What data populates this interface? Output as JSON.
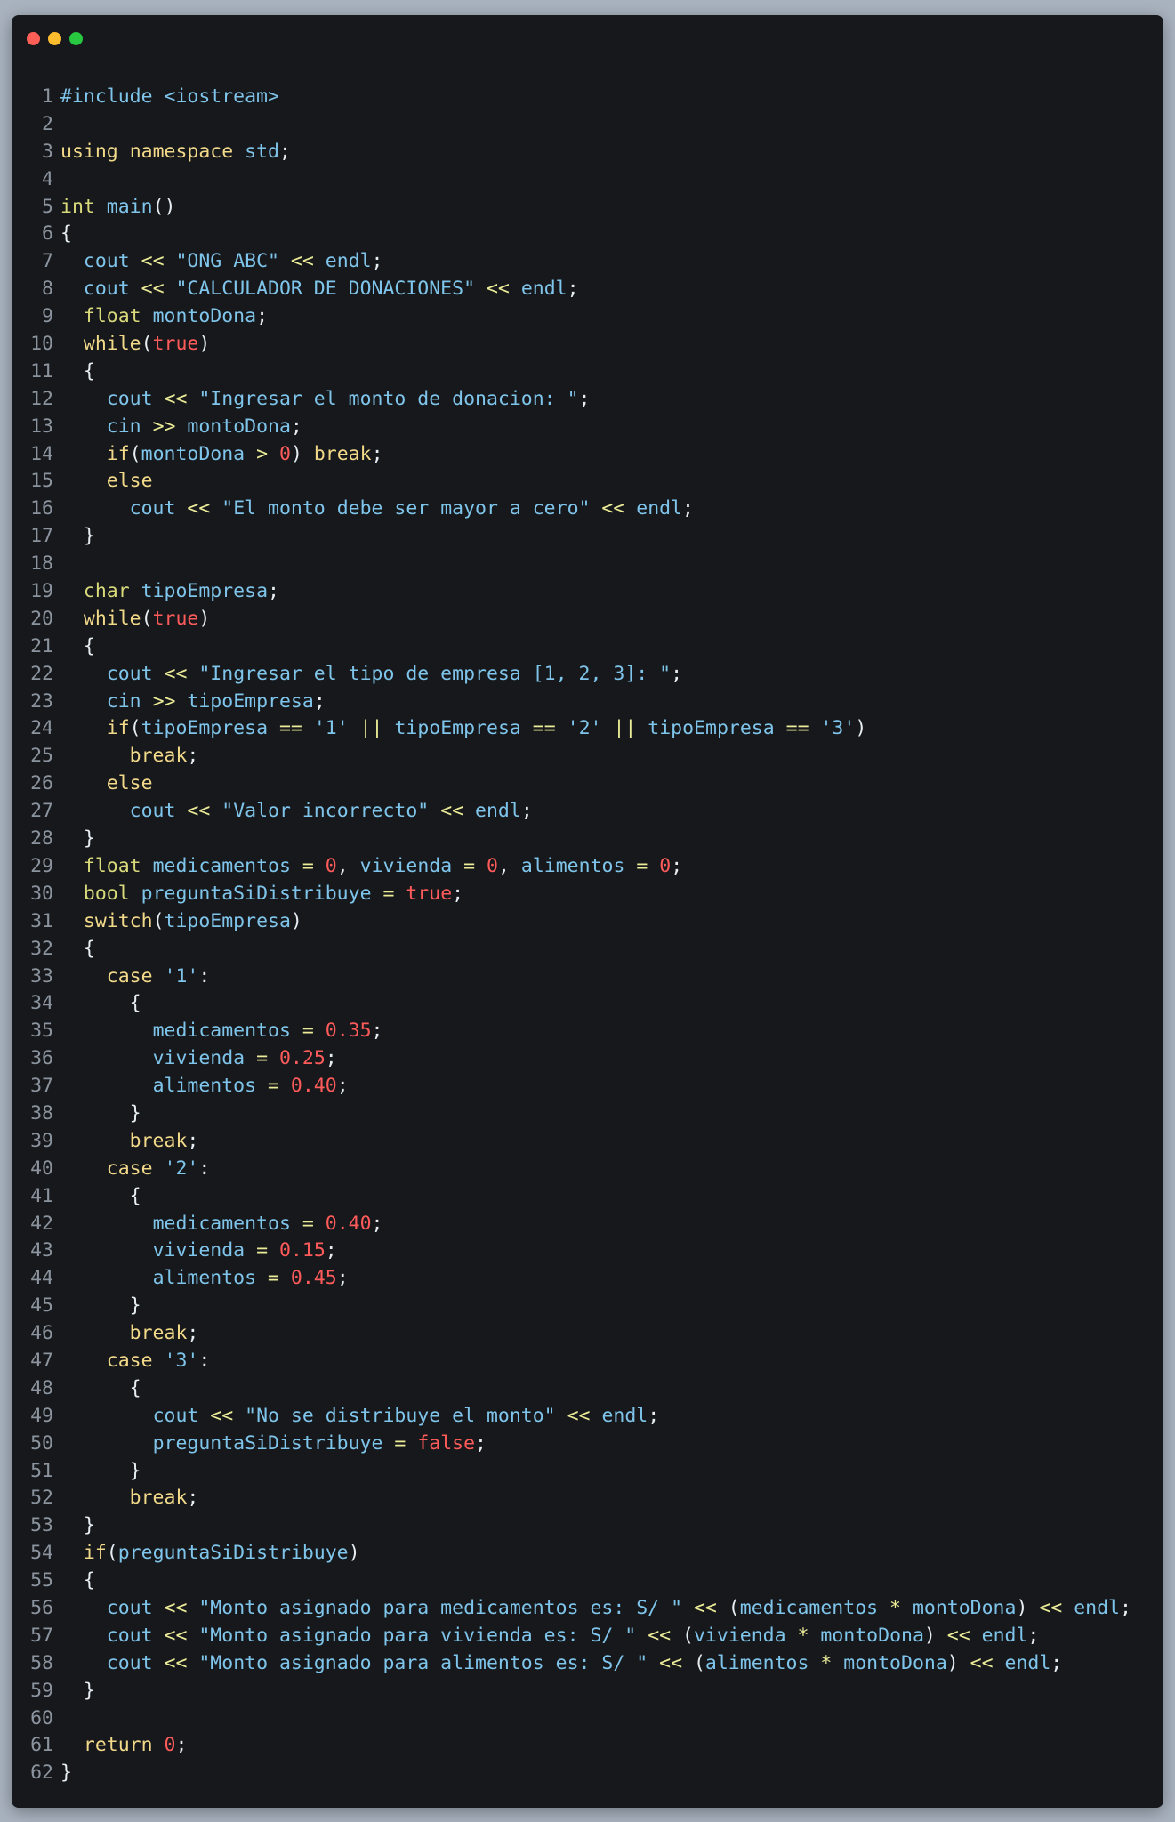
{
  "window": {
    "controls": [
      "close",
      "minimize",
      "maximize"
    ],
    "colors": {
      "background": "#16181b",
      "page": "#a9b3bf"
    }
  },
  "code": {
    "language": "cpp",
    "lines": [
      [
        [
          "s",
          "#include <iostream>"
        ]
      ],
      [],
      [
        [
          "k",
          "using"
        ],
        [
          "p",
          " "
        ],
        [
          "k",
          "namespace"
        ],
        [
          "p",
          " "
        ],
        [
          "s",
          "std"
        ],
        [
          "p",
          ";"
        ]
      ],
      [],
      [
        [
          "t",
          "int"
        ],
        [
          "p",
          " "
        ],
        [
          "s",
          "main"
        ],
        [
          "p",
          "()"
        ]
      ],
      [
        [
          "p",
          "{"
        ]
      ],
      [
        [
          "p",
          "  "
        ],
        [
          "s",
          "cout"
        ],
        [
          "p",
          " "
        ],
        [
          "o",
          "<<"
        ],
        [
          "p",
          " "
        ],
        [
          "s",
          "\"ONG ABC\""
        ],
        [
          "p",
          " "
        ],
        [
          "o",
          "<<"
        ],
        [
          "p",
          " "
        ],
        [
          "s",
          "endl"
        ],
        [
          "p",
          ";"
        ]
      ],
      [
        [
          "p",
          "  "
        ],
        [
          "s",
          "cout"
        ],
        [
          "p",
          " "
        ],
        [
          "o",
          "<<"
        ],
        [
          "p",
          " "
        ],
        [
          "s",
          "\"CALCULADOR DE DONACIONES\""
        ],
        [
          "p",
          " "
        ],
        [
          "o",
          "<<"
        ],
        [
          "p",
          " "
        ],
        [
          "s",
          "endl"
        ],
        [
          "p",
          ";"
        ]
      ],
      [
        [
          "p",
          "  "
        ],
        [
          "t",
          "float"
        ],
        [
          "p",
          " "
        ],
        [
          "s",
          "montoDona"
        ],
        [
          "p",
          ";"
        ]
      ],
      [
        [
          "p",
          "  "
        ],
        [
          "k",
          "while"
        ],
        [
          "p",
          "("
        ],
        [
          "n",
          "true"
        ],
        [
          "p",
          ")"
        ]
      ],
      [
        [
          "p",
          "  {"
        ]
      ],
      [
        [
          "p",
          "    "
        ],
        [
          "s",
          "cout"
        ],
        [
          "p",
          " "
        ],
        [
          "o",
          "<<"
        ],
        [
          "p",
          " "
        ],
        [
          "s",
          "\"Ingresar el monto de donacion: \""
        ],
        [
          "p",
          ";"
        ]
      ],
      [
        [
          "p",
          "    "
        ],
        [
          "s",
          "cin"
        ],
        [
          "p",
          " "
        ],
        [
          "o",
          ">>"
        ],
        [
          "p",
          " "
        ],
        [
          "s",
          "montoDona"
        ],
        [
          "p",
          ";"
        ]
      ],
      [
        [
          "p",
          "    "
        ],
        [
          "k",
          "if"
        ],
        [
          "p",
          "("
        ],
        [
          "s",
          "montoDona"
        ],
        [
          "p",
          " "
        ],
        [
          "o",
          ">"
        ],
        [
          "p",
          " "
        ],
        [
          "n",
          "0"
        ],
        [
          "p",
          ") "
        ],
        [
          "k",
          "break"
        ],
        [
          "p",
          ";"
        ]
      ],
      [
        [
          "p",
          "    "
        ],
        [
          "k",
          "else"
        ]
      ],
      [
        [
          "p",
          "      "
        ],
        [
          "s",
          "cout"
        ],
        [
          "p",
          " "
        ],
        [
          "o",
          "<<"
        ],
        [
          "p",
          " "
        ],
        [
          "s",
          "\"El monto debe ser mayor a cero\""
        ],
        [
          "p",
          " "
        ],
        [
          "o",
          "<<"
        ],
        [
          "p",
          " "
        ],
        [
          "s",
          "endl"
        ],
        [
          "p",
          ";"
        ]
      ],
      [
        [
          "p",
          "  }"
        ]
      ],
      [],
      [
        [
          "p",
          "  "
        ],
        [
          "t",
          "char"
        ],
        [
          "p",
          " "
        ],
        [
          "s",
          "tipoEmpresa"
        ],
        [
          "p",
          ";"
        ]
      ],
      [
        [
          "p",
          "  "
        ],
        [
          "k",
          "while"
        ],
        [
          "p",
          "("
        ],
        [
          "n",
          "true"
        ],
        [
          "p",
          ")"
        ]
      ],
      [
        [
          "p",
          "  {"
        ]
      ],
      [
        [
          "p",
          "    "
        ],
        [
          "s",
          "cout"
        ],
        [
          "p",
          " "
        ],
        [
          "o",
          "<<"
        ],
        [
          "p",
          " "
        ],
        [
          "s",
          "\"Ingresar el tipo de empresa [1, 2, 3]: \""
        ],
        [
          "p",
          ";"
        ]
      ],
      [
        [
          "p",
          "    "
        ],
        [
          "s",
          "cin"
        ],
        [
          "p",
          " "
        ],
        [
          "o",
          ">>"
        ],
        [
          "p",
          " "
        ],
        [
          "s",
          "tipoEmpresa"
        ],
        [
          "p",
          ";"
        ]
      ],
      [
        [
          "p",
          "    "
        ],
        [
          "k",
          "if"
        ],
        [
          "p",
          "("
        ],
        [
          "s",
          "tipoEmpresa"
        ],
        [
          "p",
          " "
        ],
        [
          "o",
          "=="
        ],
        [
          "p",
          " "
        ],
        [
          "s",
          "'1'"
        ],
        [
          "p",
          " "
        ],
        [
          "o",
          "||"
        ],
        [
          "p",
          " "
        ],
        [
          "s",
          "tipoEmpresa"
        ],
        [
          "p",
          " "
        ],
        [
          "o",
          "=="
        ],
        [
          "p",
          " "
        ],
        [
          "s",
          "'2'"
        ],
        [
          "p",
          " "
        ],
        [
          "o",
          "||"
        ],
        [
          "p",
          " "
        ],
        [
          "s",
          "tipoEmpresa"
        ],
        [
          "p",
          " "
        ],
        [
          "o",
          "=="
        ],
        [
          "p",
          " "
        ],
        [
          "s",
          "'3'"
        ],
        [
          "p",
          ")"
        ]
      ],
      [
        [
          "p",
          "      "
        ],
        [
          "k",
          "break"
        ],
        [
          "p",
          ";"
        ]
      ],
      [
        [
          "p",
          "    "
        ],
        [
          "k",
          "else"
        ]
      ],
      [
        [
          "p",
          "      "
        ],
        [
          "s",
          "cout"
        ],
        [
          "p",
          " "
        ],
        [
          "o",
          "<<"
        ],
        [
          "p",
          " "
        ],
        [
          "s",
          "\"Valor incorrecto\""
        ],
        [
          "p",
          " "
        ],
        [
          "o",
          "<<"
        ],
        [
          "p",
          " "
        ],
        [
          "s",
          "endl"
        ],
        [
          "p",
          ";"
        ]
      ],
      [
        [
          "p",
          "  }"
        ]
      ],
      [
        [
          "p",
          "  "
        ],
        [
          "t",
          "float"
        ],
        [
          "p",
          " "
        ],
        [
          "s",
          "medicamentos"
        ],
        [
          "p",
          " "
        ],
        [
          "o",
          "="
        ],
        [
          "p",
          " "
        ],
        [
          "n",
          "0"
        ],
        [
          "p",
          ", "
        ],
        [
          "s",
          "vivienda"
        ],
        [
          "p",
          " "
        ],
        [
          "o",
          "="
        ],
        [
          "p",
          " "
        ],
        [
          "n",
          "0"
        ],
        [
          "p",
          ", "
        ],
        [
          "s",
          "alimentos"
        ],
        [
          "p",
          " "
        ],
        [
          "o",
          "="
        ],
        [
          "p",
          " "
        ],
        [
          "n",
          "0"
        ],
        [
          "p",
          ";"
        ]
      ],
      [
        [
          "p",
          "  "
        ],
        [
          "t",
          "bool"
        ],
        [
          "p",
          " "
        ],
        [
          "s",
          "preguntaSiDistribuye"
        ],
        [
          "p",
          " "
        ],
        [
          "o",
          "="
        ],
        [
          "p",
          " "
        ],
        [
          "n",
          "true"
        ],
        [
          "p",
          ";"
        ]
      ],
      [
        [
          "p",
          "  "
        ],
        [
          "k",
          "switch"
        ],
        [
          "p",
          "("
        ],
        [
          "s",
          "tipoEmpresa"
        ],
        [
          "p",
          ")"
        ]
      ],
      [
        [
          "p",
          "  {"
        ]
      ],
      [
        [
          "p",
          "    "
        ],
        [
          "k",
          "case"
        ],
        [
          "p",
          " "
        ],
        [
          "s",
          "'1'"
        ],
        [
          "p",
          ":"
        ]
      ],
      [
        [
          "p",
          "      {"
        ]
      ],
      [
        [
          "p",
          "        "
        ],
        [
          "s",
          "medicamentos"
        ],
        [
          "p",
          " "
        ],
        [
          "o",
          "="
        ],
        [
          "p",
          " "
        ],
        [
          "n",
          "0.35"
        ],
        [
          "p",
          ";"
        ]
      ],
      [
        [
          "p",
          "        "
        ],
        [
          "s",
          "vivienda"
        ],
        [
          "p",
          " "
        ],
        [
          "o",
          "="
        ],
        [
          "p",
          " "
        ],
        [
          "n",
          "0.25"
        ],
        [
          "p",
          ";"
        ]
      ],
      [
        [
          "p",
          "        "
        ],
        [
          "s",
          "alimentos"
        ],
        [
          "p",
          " "
        ],
        [
          "o",
          "="
        ],
        [
          "p",
          " "
        ],
        [
          "n",
          "0.40"
        ],
        [
          "p",
          ";"
        ]
      ],
      [
        [
          "p",
          "      }"
        ]
      ],
      [
        [
          "p",
          "      "
        ],
        [
          "k",
          "break"
        ],
        [
          "p",
          ";"
        ]
      ],
      [
        [
          "p",
          "    "
        ],
        [
          "k",
          "case"
        ],
        [
          "p",
          " "
        ],
        [
          "s",
          "'2'"
        ],
        [
          "p",
          ":"
        ]
      ],
      [
        [
          "p",
          "      {"
        ]
      ],
      [
        [
          "p",
          "        "
        ],
        [
          "s",
          "medicamentos"
        ],
        [
          "p",
          " "
        ],
        [
          "o",
          "="
        ],
        [
          "p",
          " "
        ],
        [
          "n",
          "0.40"
        ],
        [
          "p",
          ";"
        ]
      ],
      [
        [
          "p",
          "        "
        ],
        [
          "s",
          "vivienda"
        ],
        [
          "p",
          " "
        ],
        [
          "o",
          "="
        ],
        [
          "p",
          " "
        ],
        [
          "n",
          "0.15"
        ],
        [
          "p",
          ";"
        ]
      ],
      [
        [
          "p",
          "        "
        ],
        [
          "s",
          "alimentos"
        ],
        [
          "p",
          " "
        ],
        [
          "o",
          "="
        ],
        [
          "p",
          " "
        ],
        [
          "n",
          "0.45"
        ],
        [
          "p",
          ";"
        ]
      ],
      [
        [
          "p",
          "      }"
        ]
      ],
      [
        [
          "p",
          "      "
        ],
        [
          "k",
          "break"
        ],
        [
          "p",
          ";"
        ]
      ],
      [
        [
          "p",
          "    "
        ],
        [
          "k",
          "case"
        ],
        [
          "p",
          " "
        ],
        [
          "s",
          "'3'"
        ],
        [
          "p",
          ":"
        ]
      ],
      [
        [
          "p",
          "      {"
        ]
      ],
      [
        [
          "p",
          "        "
        ],
        [
          "s",
          "cout"
        ],
        [
          "p",
          " "
        ],
        [
          "o",
          "<<"
        ],
        [
          "p",
          " "
        ],
        [
          "s",
          "\"No se distribuye el monto\""
        ],
        [
          "p",
          " "
        ],
        [
          "o",
          "<<"
        ],
        [
          "p",
          " "
        ],
        [
          "s",
          "endl"
        ],
        [
          "p",
          ";"
        ]
      ],
      [
        [
          "p",
          "        "
        ],
        [
          "s",
          "preguntaSiDistribuye"
        ],
        [
          "p",
          " "
        ],
        [
          "o",
          "="
        ],
        [
          "p",
          " "
        ],
        [
          "n",
          "false"
        ],
        [
          "p",
          ";"
        ]
      ],
      [
        [
          "p",
          "      }"
        ]
      ],
      [
        [
          "p",
          "      "
        ],
        [
          "k",
          "break"
        ],
        [
          "p",
          ";"
        ]
      ],
      [
        [
          "p",
          "  }"
        ]
      ],
      [
        [
          "p",
          "  "
        ],
        [
          "k",
          "if"
        ],
        [
          "p",
          "("
        ],
        [
          "s",
          "preguntaSiDistribuye"
        ],
        [
          "p",
          ")"
        ]
      ],
      [
        [
          "p",
          "  {"
        ]
      ],
      [
        [
          "p",
          "    "
        ],
        [
          "s",
          "cout"
        ],
        [
          "p",
          " "
        ],
        [
          "o",
          "<<"
        ],
        [
          "p",
          " "
        ],
        [
          "s",
          "\"Monto asignado para medicamentos es: S/ \""
        ],
        [
          "p",
          " "
        ],
        [
          "o",
          "<<"
        ],
        [
          "p",
          " ("
        ],
        [
          "s",
          "medicamentos"
        ],
        [
          "p",
          " "
        ],
        [
          "o",
          "*"
        ],
        [
          "p",
          " "
        ],
        [
          "s",
          "montoDona"
        ],
        [
          "p",
          ") "
        ],
        [
          "o",
          "<<"
        ],
        [
          "p",
          " "
        ],
        [
          "s",
          "endl"
        ],
        [
          "p",
          ";"
        ]
      ],
      [
        [
          "p",
          "    "
        ],
        [
          "s",
          "cout"
        ],
        [
          "p",
          " "
        ],
        [
          "o",
          "<<"
        ],
        [
          "p",
          " "
        ],
        [
          "s",
          "\"Monto asignado para vivienda es: S/ \""
        ],
        [
          "p",
          " "
        ],
        [
          "o",
          "<<"
        ],
        [
          "p",
          " ("
        ],
        [
          "s",
          "vivienda"
        ],
        [
          "p",
          " "
        ],
        [
          "o",
          "*"
        ],
        [
          "p",
          " "
        ],
        [
          "s",
          "montoDona"
        ],
        [
          "p",
          ") "
        ],
        [
          "o",
          "<<"
        ],
        [
          "p",
          " "
        ],
        [
          "s",
          "endl"
        ],
        [
          "p",
          ";"
        ]
      ],
      [
        [
          "p",
          "    "
        ],
        [
          "s",
          "cout"
        ],
        [
          "p",
          " "
        ],
        [
          "o",
          "<<"
        ],
        [
          "p",
          " "
        ],
        [
          "s",
          "\"Monto asignado para alimentos es: S/ \""
        ],
        [
          "p",
          " "
        ],
        [
          "o",
          "<<"
        ],
        [
          "p",
          " ("
        ],
        [
          "s",
          "alimentos"
        ],
        [
          "p",
          " "
        ],
        [
          "o",
          "*"
        ],
        [
          "p",
          " "
        ],
        [
          "s",
          "montoDona"
        ],
        [
          "p",
          ") "
        ],
        [
          "o",
          "<<"
        ],
        [
          "p",
          " "
        ],
        [
          "s",
          "endl"
        ],
        [
          "p",
          ";"
        ]
      ],
      [
        [
          "p",
          "  }"
        ]
      ],
      [],
      [
        [
          "p",
          "  "
        ],
        [
          "k",
          "return"
        ],
        [
          "p",
          " "
        ],
        [
          "n",
          "0"
        ],
        [
          "p",
          ";"
        ]
      ],
      [
        [
          "p",
          "}"
        ]
      ]
    ]
  }
}
